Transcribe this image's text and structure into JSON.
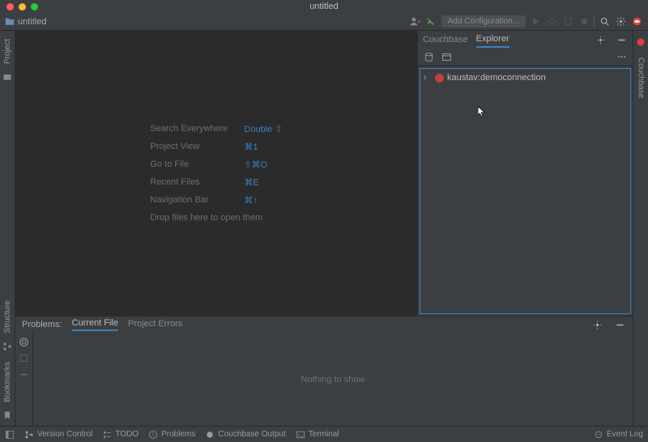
{
  "window": {
    "title": "untitled"
  },
  "toolbar": {
    "project_name": "untitled",
    "add_config": "Add Configuration..."
  },
  "left_tabs": {
    "project": "Project",
    "structure": "Structure",
    "bookmarks": "Bookmarks"
  },
  "right_tabs": {
    "couchbase": "Couchbase"
  },
  "editor_hints": {
    "search_label": "Search Everywhere",
    "search_sc": "Double ⇧",
    "project_view_label": "Project View",
    "project_view_sc": "⌘1",
    "goto_file_label": "Go to File",
    "goto_file_sc": "⇧⌘O",
    "recent_files_label": "Recent Files",
    "recent_files_sc": "⌘E",
    "navbar_label": "Navigation Bar",
    "navbar_sc": "⌘↑",
    "drop_label": "Drop files here to open them"
  },
  "panel": {
    "tab_couchbase": "Couchbase",
    "tab_explorer": "Explorer",
    "tree": {
      "conn_label": "kaustav:democonnection"
    },
    "more": "···"
  },
  "problems": {
    "title": "Problems:",
    "tab_current": "Current File",
    "tab_project": "Project Errors",
    "empty": "Nothing to show"
  },
  "status": {
    "version_control": "Version Control",
    "todo": "TODO",
    "problems": "Problems",
    "couchbase_output": "Couchbase Output",
    "terminal": "Terminal",
    "event_log": "Event Log"
  }
}
